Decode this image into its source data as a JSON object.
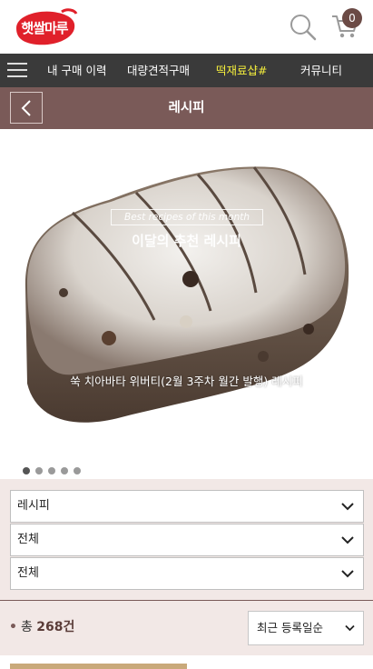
{
  "header": {
    "logo_text": "햇쌀마루",
    "cart_count": "0",
    "brand_color": "#e0202a"
  },
  "nav": {
    "items": [
      {
        "label": "내 구매 이력"
      },
      {
        "label": "대량견적구매"
      },
      {
        "label": "떡재료샵#"
      },
      {
        "label": "커뮤니티"
      }
    ],
    "active_color": "#f4ee3c"
  },
  "titlebar": {
    "title": "레시피"
  },
  "hero": {
    "banner_en": "Best recipes of this month",
    "banner_ko": "이달의 추천 레시피",
    "caption": "쑥 치아바타 위버티(2월 3주차 월간 발행) 레시피",
    "slide_count": 5,
    "current_slide": 1
  },
  "filters": [
    {
      "value": "레시피"
    },
    {
      "value": "전체"
    },
    {
      "value": "전체"
    }
  ],
  "count": {
    "prefix": "총",
    "number": "268건"
  },
  "sort": {
    "value": "최근 등록일순"
  }
}
